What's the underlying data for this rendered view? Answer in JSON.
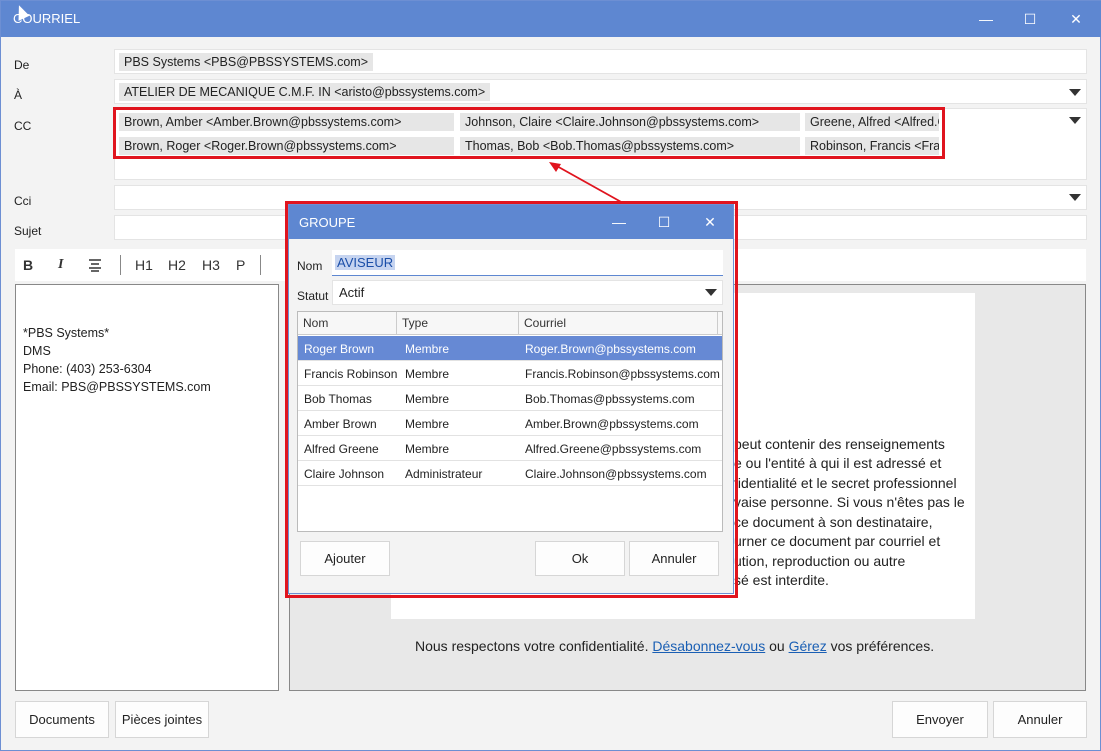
{
  "window": {
    "title": "COURRIEL",
    "minimize": "—",
    "maximize": "☐",
    "close": "✕"
  },
  "form": {
    "from_label": "De",
    "from_value": "PBS Systems <PBS@PBSSYSTEMS.com>",
    "to_label": "À",
    "to_value": "ATELIER DE MECANIQUE C.M.F. IN <aristo@pbssystems.com>",
    "cc_label": "CC",
    "cc_recipients": [
      "Brown, Amber <Amber.Brown@pbssystems.com>",
      "Johnson, Claire <Claire.Johnson@pbssystems.com>",
      "Greene, Alfred <Alfred.Greene@pbssystems.com>",
      "Brown, Roger <Roger.Brown@pbssystems.com>",
      "Thomas, Bob <Bob.Thomas@pbssystems.com>",
      "Robinson, Francis <Francis.Robinson@pbssystems.com>"
    ],
    "bcc_label": "Cci",
    "subject_label": "Sujet"
  },
  "toolbar": {
    "bold": "B",
    "italic": "I",
    "h1": "H1",
    "h2": "H2",
    "h3": "H3",
    "p": "P"
  },
  "signature": [
    "*PBS Systems*",
    "DMS",
    "Phone: (403) 253-6304",
    "Email: PBS@PBSSYSTEMS.com"
  ],
  "preview": {
    "lines": [
      "peut contenir des renseignements",
      "e ou l'entité à qui il est adressé et",
      "fidentialité et le secret professionnel",
      "vaise personne. Si vous n'êtes pas le",
      " ce document à son destinataire,",
      "urner ce document par courriel et",
      "ution, reproduction ou autre",
      "sé est interdite."
    ],
    "footer_prefix": "Nous respectons votre confidentialité. ",
    "footer_link1": "Désabonnez-vous",
    "footer_mid": " ou ",
    "footer_link2": "Gérez",
    "footer_suffix": " vos préférences."
  },
  "buttons": {
    "documents": "Documents",
    "attachments": "Pièces jointes",
    "send": "Envoyer",
    "cancel": "Annuler"
  },
  "dialog": {
    "title": "GROUPE",
    "name_label": "Nom",
    "name_value": "AVISEUR",
    "status_label": "Statut",
    "status_value": "Actif",
    "columns": [
      "Nom",
      "Type",
      "Courriel"
    ],
    "rows": [
      {
        "name": "Roger Brown",
        "type": "Membre",
        "email": "Roger.Brown@pbssystems.com"
      },
      {
        "name": "Francis Robinson",
        "type": "Membre",
        "email": "Francis.Robinson@pbssystems.com"
      },
      {
        "name": "Bob Thomas",
        "type": "Membre",
        "email": "Bob.Thomas@pbssystems.com"
      },
      {
        "name": "Amber Brown",
        "type": "Membre",
        "email": "Amber.Brown@pbssystems.com"
      },
      {
        "name": "Alfred Greene",
        "type": "Membre",
        "email": "Alfred.Greene@pbssystems.com"
      },
      {
        "name": "Claire Johnson",
        "type": "Administrateur",
        "email": "Claire.Johnson@pbssystems.com"
      }
    ],
    "add_button": "Ajouter",
    "ok_button": "Ok",
    "cancel_button": "Annuler"
  },
  "colors": {
    "titlebar": "#5e87d1",
    "highlight": "#e0141e",
    "selection": "#6689d4",
    "link": "#1a5fb4"
  }
}
